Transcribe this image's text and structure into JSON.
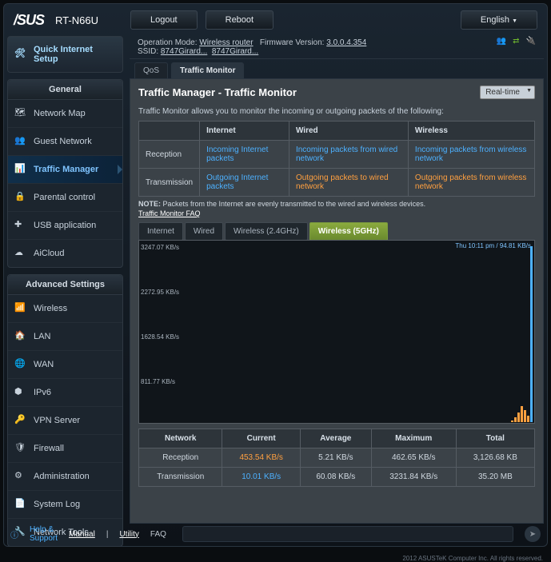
{
  "header": {
    "brand": "/SUS",
    "model": "RT-N66U",
    "logout": "Logout",
    "reboot": "Reboot",
    "language": "English"
  },
  "info": {
    "op_mode_label": "Operation Mode:",
    "op_mode": "Wireless router",
    "fw_label": "Firmware Version:",
    "fw": "3.0.0.4.354",
    "ssid_label": "SSID:",
    "ssid1": "8747Girard...",
    "ssid2": "8747Girard..."
  },
  "qis": "Quick Internet Setup",
  "sections": {
    "general": "General",
    "advanced": "Advanced Settings"
  },
  "nav_general": [
    {
      "label": "Network Map"
    },
    {
      "label": "Guest Network"
    },
    {
      "label": "Traffic Manager"
    },
    {
      "label": "Parental control"
    },
    {
      "label": "USB application"
    },
    {
      "label": "AiCloud"
    }
  ],
  "nav_adv": [
    {
      "label": "Wireless"
    },
    {
      "label": "LAN"
    },
    {
      "label": "WAN"
    },
    {
      "label": "IPv6"
    },
    {
      "label": "VPN Server"
    },
    {
      "label": "Firewall"
    },
    {
      "label": "Administration"
    },
    {
      "label": "System Log"
    },
    {
      "label": "Network Tools"
    }
  ],
  "tabs": {
    "qos": "QoS",
    "tm": "Traffic Monitor"
  },
  "content": {
    "title": "Traffic Manager - Traffic Monitor",
    "mode": "Real-time",
    "desc": "Traffic Monitor allows you to monitor the incoming or outgoing packets of the following:",
    "th": {
      "internet": "Internet",
      "wired": "Wired",
      "wireless": "Wireless"
    },
    "rows": {
      "reception": "Reception",
      "transmission": "Transmission",
      "r_i": "Incoming Internet packets",
      "r_w": "Incoming packets from wired network",
      "r_wl": "Incoming packets from wireless network",
      "t_i": "Outgoing Internet packets",
      "t_w": "Outgoing packets to wired network",
      "t_wl": "Outgoing packets from wireless network"
    },
    "note": "NOTE: Packets from the Internet are evenly transmitted to the wired and wireless devices.",
    "faq": "Traffic Monitor FAQ",
    "tabs2": {
      "internet": "Internet",
      "wired": "Wired",
      "w24": "Wireless (2.4GHz)",
      "w5": "Wireless (5GHz)"
    }
  },
  "chart_data": {
    "type": "area",
    "x": "time",
    "ylabel": "KB/s",
    "ylim": [
      0,
      3247.07
    ],
    "yticks": [
      811.77,
      1628.54,
      2272.95,
      3247.07
    ],
    "timestamp": "Thu 10:11 pm / 94.81 KB/s",
    "series": [
      {
        "name": "Reception",
        "color": "#4DB1FF",
        "latest_values": [
          5,
          8,
          6,
          7,
          220
        ]
      },
      {
        "name": "Transmission",
        "color": "#FFA040",
        "latest_values": [
          2,
          3,
          2,
          3,
          25
        ]
      }
    ]
  },
  "stats": {
    "hdr": {
      "network": "Network",
      "current": "Current",
      "avg": "Average",
      "max": "Maximum",
      "total": "Total"
    },
    "reception": {
      "label": "Reception",
      "current": "453.54 KB/s",
      "avg": "5.21 KB/s",
      "max": "462.65 KB/s",
      "total": "3,126.68 KB"
    },
    "transmission": {
      "label": "Transmission",
      "current": "10.01 KB/s",
      "avg": "60.08 KB/s",
      "max": "3231.84 KB/s",
      "total": "35.20 MB"
    }
  },
  "footer": {
    "help": "Help & Support",
    "manual": "Manual",
    "utility": "Utility",
    "faq": "FAQ",
    "cpr": "2012 ASUSTeK Computer Inc. All rights reserved."
  }
}
